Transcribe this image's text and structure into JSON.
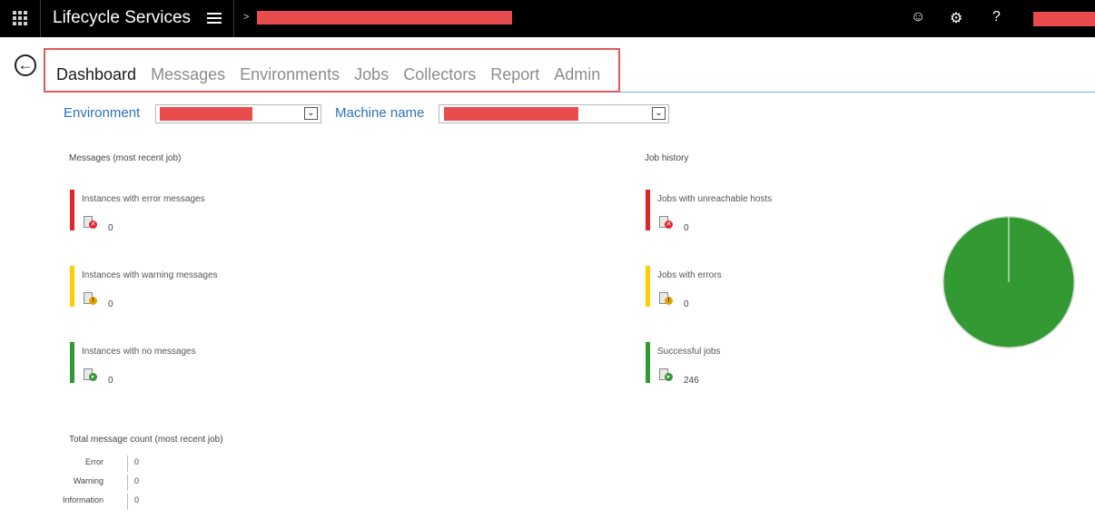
{
  "header": {
    "app_title": "Lifecycle Services",
    "breadcrumb_chevron": ">",
    "icons": [
      "waffle-icon",
      "hamburger-icon",
      "smiley-icon",
      "gear-icon",
      "help-icon"
    ],
    "smiley_glyph": "☺",
    "gear_glyph": "⚙",
    "help_glyph": "?"
  },
  "nav": {
    "back_glyph": "←",
    "tabs": [
      "Dashboard",
      "Messages",
      "Environments",
      "Jobs",
      "Collectors",
      "Report",
      "Admin"
    ],
    "active_tab": "Dashboard"
  },
  "filters": {
    "environment_label": "Environment",
    "machine_label": "Machine name",
    "arrow_glyph": "⌄"
  },
  "messages": {
    "title": "Messages (most recent job)",
    "items": [
      {
        "label": "Instances with error messages",
        "count": "0",
        "status": "error",
        "color": "#e3242b"
      },
      {
        "label": "Instances with warning messages",
        "count": "0",
        "status": "warning",
        "color": "#ffcc00"
      },
      {
        "label": "Instances with no messages",
        "count": "0",
        "status": "success",
        "color": "#339933"
      }
    ]
  },
  "jobs": {
    "title": "Job history",
    "items": [
      {
        "label": "Jobs with unreachable hosts",
        "count": "0",
        "status": "error",
        "color": "#e3242b"
      },
      {
        "label": "Jobs with errors",
        "count": "0",
        "status": "warning",
        "color": "#ffcc00"
      },
      {
        "label": "Successful jobs",
        "count": "246",
        "status": "success",
        "color": "#339933"
      }
    ]
  },
  "chart_data": {
    "type": "pie",
    "categories": [
      "Jobs with unreachable hosts",
      "Jobs with errors",
      "Successful jobs"
    ],
    "values": [
      0,
      0,
      246
    ],
    "colors": [
      "#e3242b",
      "#ffcc00",
      "#339933"
    ]
  },
  "totals": {
    "title": "Total message count (most recent job)",
    "rows": [
      {
        "label": "Error",
        "value": "0"
      },
      {
        "label": "Warning",
        "value": "0"
      },
      {
        "label": "Information",
        "value": "0"
      }
    ]
  }
}
